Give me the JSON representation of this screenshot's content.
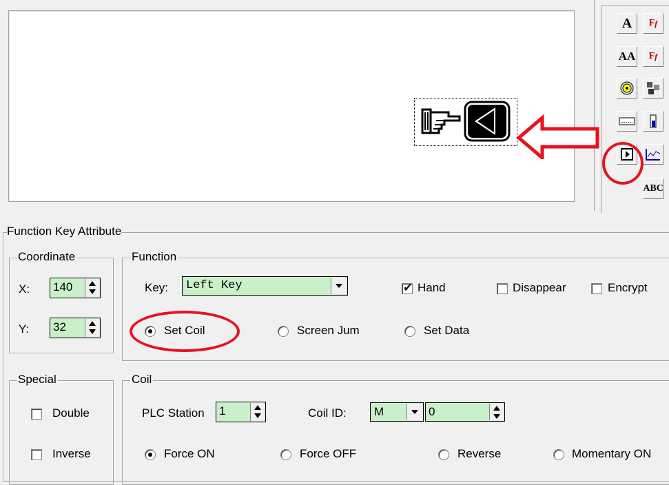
{
  "toolbar": {
    "buttons": [
      {
        "icon": "text-icon",
        "label": "A"
      },
      {
        "icon": "font-format-icon",
        "label": "F"
      },
      {
        "icon": "dynamic-text-icon",
        "label": "AA"
      },
      {
        "icon": "font-format-2-icon",
        "label": "F"
      },
      {
        "icon": "lamp-icon",
        "label": ""
      },
      {
        "icon": "multi-state-icon",
        "label": ""
      },
      {
        "icon": "numeric-display-icon",
        "label": ""
      },
      {
        "icon": "bar-graph-icon",
        "label": ""
      },
      {
        "icon": "function-key-icon",
        "label": ""
      },
      {
        "icon": "trend-graph-icon",
        "label": ""
      },
      {
        "icon": "ascii-input-icon",
        "label": "ABC"
      }
    ]
  },
  "attribute": {
    "title": "Function Key Attribute",
    "coordinate": {
      "legend": "Coordinate",
      "x_label": "X:",
      "x_value": "140",
      "y_label": "Y:",
      "y_value": "32"
    },
    "function": {
      "legend": "Function",
      "key_label": "Key:",
      "key_value": "Left Key",
      "hand_label": "Hand",
      "hand_checked": true,
      "disappear_label": "Disappear",
      "encrypt_label": "Encrypt",
      "set_coil_label": "Set Coil",
      "screen_jump_label": "Screen Jum",
      "set_data_label": "Set Data",
      "selected": "Set Coil"
    },
    "special": {
      "legend": "Special",
      "double_label": "Double",
      "inverse_label": "Inverse"
    },
    "coil": {
      "legend": "Coil",
      "plc_station_label": "PLC Station",
      "plc_station_value": "1",
      "coil_id_label": "Coil ID:",
      "coil_type": "M",
      "coil_number": "0",
      "force_on_label": "Force ON",
      "force_off_label": "Force OFF",
      "reverse_label": "Reverse",
      "momentary_on_label": "Momentary ON",
      "selected": "Force ON"
    }
  },
  "colors": {
    "annotation_red": "#e8111e",
    "input_green": "#c9f0c9",
    "window_bg": "#f0f0f0"
  }
}
